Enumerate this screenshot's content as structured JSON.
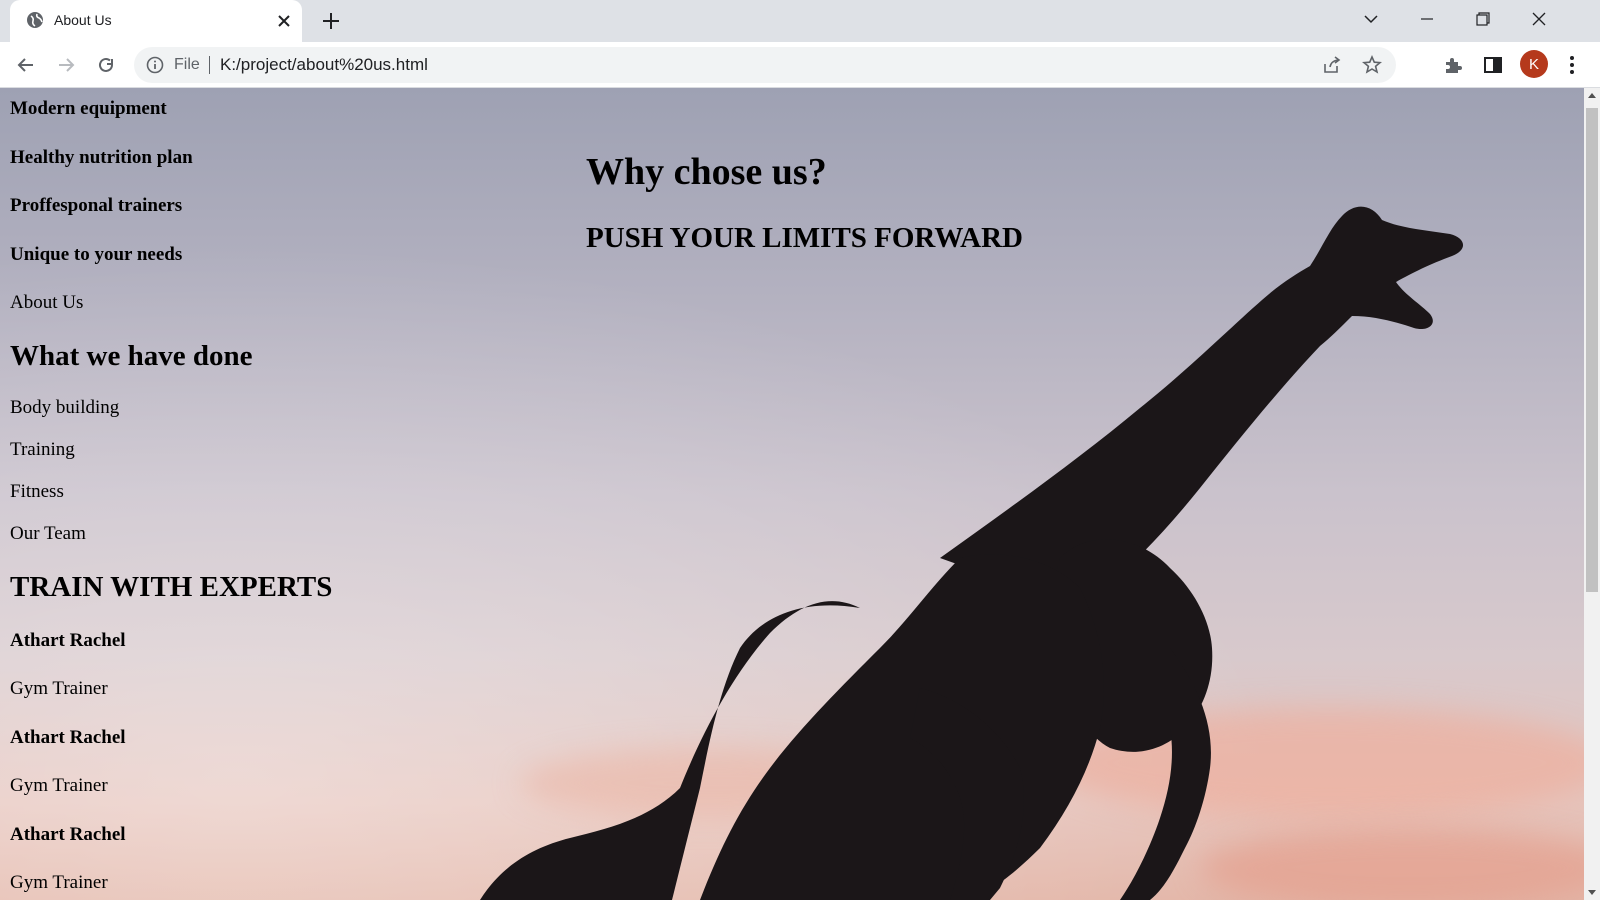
{
  "browser": {
    "tab_title": "About Us",
    "omnibox_scheme": "File",
    "url": "K:/project/about%20us.html",
    "avatar_letter": "K",
    "avatar_color": "#b5391c"
  },
  "page": {
    "features": [
      "Modern equipment",
      "Healthy nutrition plan",
      "Proffesponal trainers",
      "Unique to your needs"
    ],
    "about_link": "About Us",
    "done_heading": "What we have done",
    "services": [
      "Body building",
      "Training",
      "Fitness"
    ],
    "team_link": "Our Team",
    "experts_heading": "TRAIN WITH EXPERTS",
    "trainers": [
      {
        "name": "Athart Rachel",
        "role": "Gym Trainer"
      },
      {
        "name": "Athart Rachel",
        "role": "Gym Trainer"
      },
      {
        "name": "Athart Rachel",
        "role": "Gym Trainer"
      }
    ],
    "why_heading": "Why chose us?",
    "tagline": "PUSH YOUR LIMITS FORWARD"
  }
}
